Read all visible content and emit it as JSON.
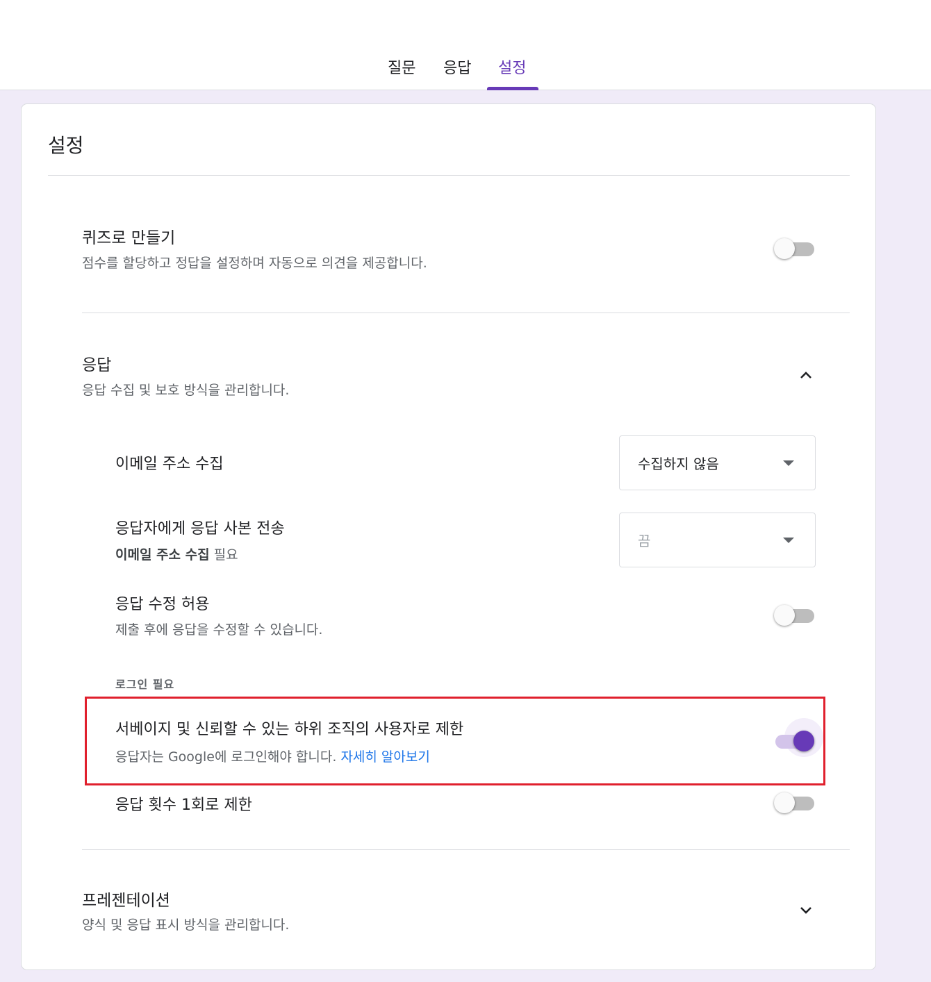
{
  "tabs": [
    {
      "label": "질문",
      "active": false
    },
    {
      "label": "응답",
      "active": false
    },
    {
      "label": "설정",
      "active": true
    }
  ],
  "settings": {
    "page_title": "설정",
    "quiz": {
      "title": "퀴즈로 만들기",
      "subtitle": "점수를 할당하고 정답을 설정하며 자동으로 의견을 제공합니다.",
      "toggle_on": false
    },
    "responses": {
      "title": "응답",
      "subtitle": "응답 수집 및 보호 방식을 관리합니다.",
      "expanded": true,
      "collect_email": {
        "label": "이메일 주소 수집",
        "value": "수집하지 않음"
      },
      "send_copy": {
        "label": "응답자에게 응답 사본 전송",
        "note_bold": "이메일 주소 수집",
        "note_rest": " 필요",
        "value": "끔"
      },
      "allow_edit": {
        "label": "응답 수정 허용",
        "subtitle": "제출 후에 응답을 수정할 수 있습니다.",
        "toggle_on": false
      },
      "login_required_heading": "로그인 필요",
      "restrict_org": {
        "label": "서베이지 및 신뢰할 수 있는 하위 조직의 사용자로 제한",
        "subtitle": "응답자는 Google에 로그인해야 합니다. ",
        "link": "자세히 알아보기",
        "toggle_on": true
      },
      "limit_one": {
        "label": "응답 횟수 1회로 제한",
        "toggle_on": false
      }
    },
    "presentation": {
      "title": "프레젠테이션",
      "subtitle": "양식 및 응답 표시 방식을 관리합니다.",
      "expanded": false
    }
  },
  "colors": {
    "accent": "#673ab7",
    "background": "#f0ebf8",
    "highlight_box": "#e0202d",
    "link": "#1a73e8"
  }
}
